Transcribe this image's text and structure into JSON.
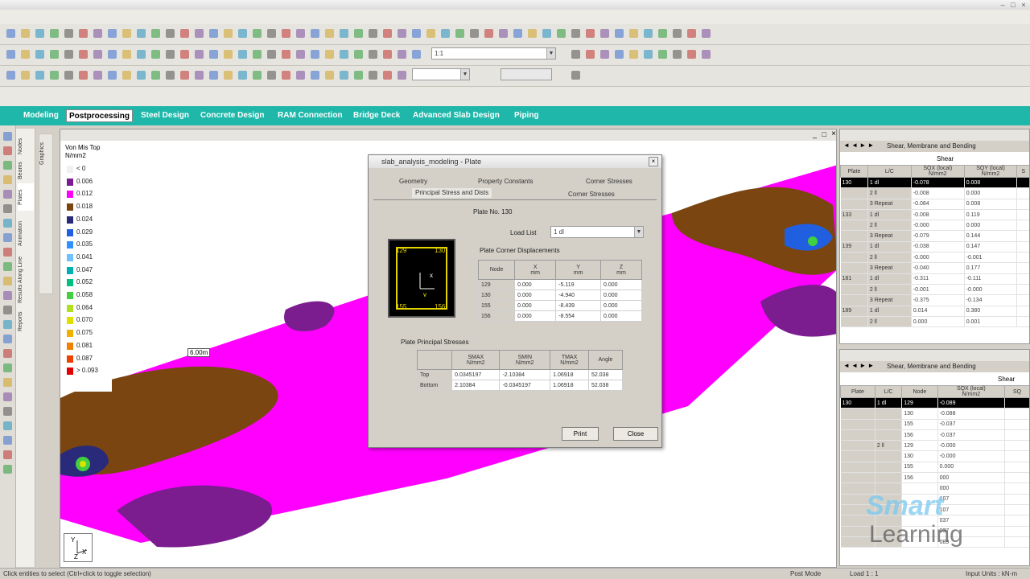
{
  "app": {
    "title": ""
  },
  "page_tabs": [
    {
      "label": "Modeling",
      "active": false
    },
    {
      "label": "Postprocessing",
      "active": true
    },
    {
      "label": "Steel Design",
      "active": false
    },
    {
      "label": "Concrete Design",
      "active": false
    },
    {
      "label": "RAM Connection",
      "active": false
    },
    {
      "label": "Bridge Deck",
      "active": false
    },
    {
      "label": "Advanced Slab Design",
      "active": false
    },
    {
      "label": "Piping",
      "active": false
    }
  ],
  "toolbar": {
    "view_combo_value": "1:1",
    "load_combo_value": ""
  },
  "left_strip_tabs": [
    "Nodes",
    "Beams",
    "Plates",
    "Animation",
    "Results Along Line",
    "Reports",
    "Graphics"
  ],
  "legend": {
    "title": "Von Mis Top",
    "unit": "N/mm2",
    "items": [
      {
        "label": "< 0",
        "color": "#f0f0f0"
      },
      {
        "label": "0.006",
        "color": "#7b1d8e"
      },
      {
        "label": "0.012",
        "color": "#ff00ff"
      },
      {
        "label": "0.018",
        "color": "#7a4510"
      },
      {
        "label": "0.024",
        "color": "#2a2a7a"
      },
      {
        "label": "0.029",
        "color": "#2060e0"
      },
      {
        "label": "0.035",
        "color": "#3090ff"
      },
      {
        "label": "0.041",
        "color": "#6fc0ff"
      },
      {
        "label": "0.047",
        "color": "#00b0b0"
      },
      {
        "label": "0.052",
        "color": "#00c080"
      },
      {
        "label": "0.058",
        "color": "#40d040"
      },
      {
        "label": "0.064",
        "color": "#b0e020"
      },
      {
        "label": "0.070",
        "color": "#e0e000"
      },
      {
        "label": "0.075",
        "color": "#f0b000"
      },
      {
        "label": "0.081",
        "color": "#f08000"
      },
      {
        "label": "0.087",
        "color": "#f04000"
      },
      {
        "label": "> 0.093",
        "color": "#e00000"
      }
    ]
  },
  "viewport": {
    "dimension_label": "6.00m",
    "axis": {
      "y": "Y",
      "x": "X",
      "z": "Z"
    }
  },
  "dialog": {
    "title": "slab_analysis_modeling - Plate",
    "tabs_row1": [
      "Geometry",
      "Property Constants",
      "Corner Stresses"
    ],
    "tabs_row2": [
      "Principal Stress and Dists",
      "Corner Stresses"
    ],
    "plate_no_label": "Plate No. 130",
    "load_list_label": "Load List",
    "load_list_value": "1 dl",
    "graphic_nodes": {
      "tl": "129",
      "tr": "130",
      "bl": "155",
      "br": "156"
    },
    "displacements": {
      "title": "Plate Corner Displacements",
      "headers": [
        "Node",
        "X\nmm",
        "Y\nmm",
        "Z\nmm"
      ],
      "rows": [
        [
          "129",
          "0.000",
          "-5.119",
          "0.000"
        ],
        [
          "130",
          "0.000",
          "-4.940",
          "0.000"
        ],
        [
          "155",
          "0.000",
          "-8.439",
          "0.000"
        ],
        [
          "156",
          "0.000",
          "-8.554",
          "0.000"
        ]
      ]
    },
    "principal": {
      "title": "Plate Principal Stresses",
      "headers": [
        "",
        "SMAX\nN/mm2",
        "SMIN\nN/mm2",
        "TMAX\nN/mm2",
        "Angle"
      ],
      "rows": [
        [
          "Top",
          "0.0345197",
          "-2.10384",
          "1.06918",
          "52.038"
        ],
        [
          "Bottom",
          "2.10384",
          "-0.0345197",
          "1.06918",
          "52.038"
        ]
      ]
    },
    "print_button": "Print",
    "close_button": "Close"
  },
  "right_panel_top": {
    "tab_label": "Shear, Membrane and Bending",
    "group_header": "Shear",
    "headers": [
      "Plate",
      "L/C",
      "SQX (local)\nN/mm2",
      "SQY (local)\nN/mm2",
      "S"
    ],
    "rows": [
      [
        "130",
        "1 dl",
        "-0.078",
        "0.008",
        ""
      ],
      [
        "",
        "2 ll",
        "-0.008",
        "0.000",
        ""
      ],
      [
        "",
        "3 Repeat",
        "-0.084",
        "0.008",
        ""
      ],
      [
        "133",
        "1 dl",
        "-0.008",
        "0.119",
        ""
      ],
      [
        "",
        "2 ll",
        "-0.000",
        "0.000",
        ""
      ],
      [
        "",
        "3 Repeat",
        "-0.079",
        "0.144",
        ""
      ],
      [
        "139",
        "1 dl",
        "-0.038",
        "0.147",
        ""
      ],
      [
        "",
        "2 ll",
        "-0.000",
        "-0.001",
        ""
      ],
      [
        "",
        "3 Repeat",
        "-0.040",
        "0.177",
        ""
      ],
      [
        "181",
        "1 dl",
        "-0.311",
        "-0.111",
        ""
      ],
      [
        "",
        "2 ll",
        "-0.001",
        "-0.000",
        ""
      ],
      [
        "",
        "3 Repeat",
        "-0.375",
        "-0.134",
        ""
      ],
      [
        "189",
        "1 dl",
        "0.014",
        "0.380",
        ""
      ],
      [
        "",
        "2 ll",
        "0.000",
        "0.001",
        ""
      ]
    ]
  },
  "right_panel_bottom": {
    "tab_label": "Shear, Membrane and Bending",
    "group_header": "Shear",
    "headers": [
      "Plate",
      "L/C",
      "Node",
      "SQX (local)\nN/mm2",
      "SQ"
    ],
    "rows": [
      [
        "130",
        "1 dl",
        "129",
        "-0.089",
        ""
      ],
      [
        "",
        "",
        "130",
        "-0.088",
        ""
      ],
      [
        "",
        "",
        "155",
        "-0.037",
        ""
      ],
      [
        "",
        "",
        "156",
        "-0.037",
        ""
      ],
      [
        "",
        "2 ll",
        "129",
        "-0.000",
        ""
      ],
      [
        "",
        "",
        "130",
        "-0.000",
        ""
      ],
      [
        "",
        "",
        "155",
        "0.000",
        ""
      ],
      [
        "",
        "",
        "156",
        "000",
        ""
      ],
      [
        "",
        "",
        "",
        "000",
        ""
      ],
      [
        "",
        "",
        "",
        "107",
        ""
      ],
      [
        "",
        "",
        "",
        "107",
        ""
      ],
      [
        "",
        "",
        "",
        "037",
        ""
      ],
      [
        "",
        "",
        "",
        "037",
        ""
      ],
      [
        "",
        "",
        "",
        "089",
        ""
      ]
    ]
  },
  "status": {
    "hint": "Click entities to select (Ctrl+click to toggle selection)",
    "mode": "Post Mode",
    "load": "Load 1 : 1",
    "units": "Input Units : kN-m"
  },
  "watermark": {
    "line1": "Smart",
    "line2": "Learning"
  }
}
